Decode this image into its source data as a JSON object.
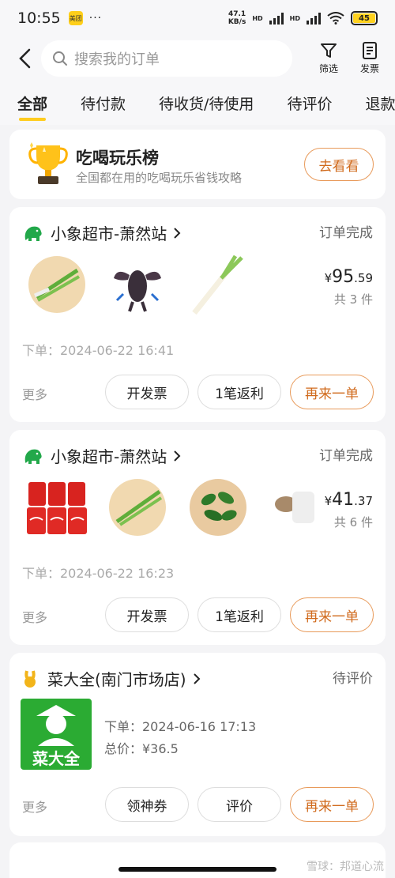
{
  "status_bar": {
    "time": "10:55",
    "app_badge": "美团",
    "dots": "···",
    "net_speed": "47.1",
    "net_unit": "KB/s",
    "hd1": "HD",
    "hd2": "HD",
    "battery": "45"
  },
  "header": {
    "search_placeholder": "搜索我的订单",
    "filter_label": "筛选",
    "invoice_label": "发票"
  },
  "tabs": [
    {
      "label": "全部",
      "active": true
    },
    {
      "label": "待付款"
    },
    {
      "label": "待收货/待使用"
    },
    {
      "label": "待评价"
    },
    {
      "label": "退款/"
    }
  ],
  "promo": {
    "title": "吃喝玩乐榜",
    "subtitle": "全国都在用的吃喝玩乐省钱攻略",
    "button": "去看看"
  },
  "orders": [
    {
      "shop": "小象超市-萧然站",
      "status": "订单完成",
      "currency": "¥",
      "price_int": "95",
      "price_dec": ".59",
      "count": "共 3 件",
      "time": "下单：2024-06-22 16:41",
      "more": "更多",
      "btn1": "开发票",
      "btn2": "1笔返利",
      "btn3": "再来一单"
    },
    {
      "shop": "小象超市-萧然站",
      "status": "订单完成",
      "currency": "¥",
      "price_int": "41",
      "price_dec": ".37",
      "count": "共 6 件",
      "time": "下单：2024-06-22 16:23",
      "more": "更多",
      "btn1": "开发票",
      "btn2": "1笔返利",
      "btn3": "再来一单"
    },
    {
      "shop": "菜大全(南门市场店)",
      "status": "待评价",
      "logo_text": "菜大全",
      "time": "下单：2024-06-16 17:13",
      "total": "总价：¥36.5",
      "more": "更多",
      "btn1": "领神券",
      "btn2": "评价",
      "btn3": "再来一单"
    }
  ],
  "watermark": "雪球：邦道心流",
  "colors": {
    "accent": "#ffcc1f",
    "orange": "#d06a1c",
    "green": "#2bab33"
  }
}
